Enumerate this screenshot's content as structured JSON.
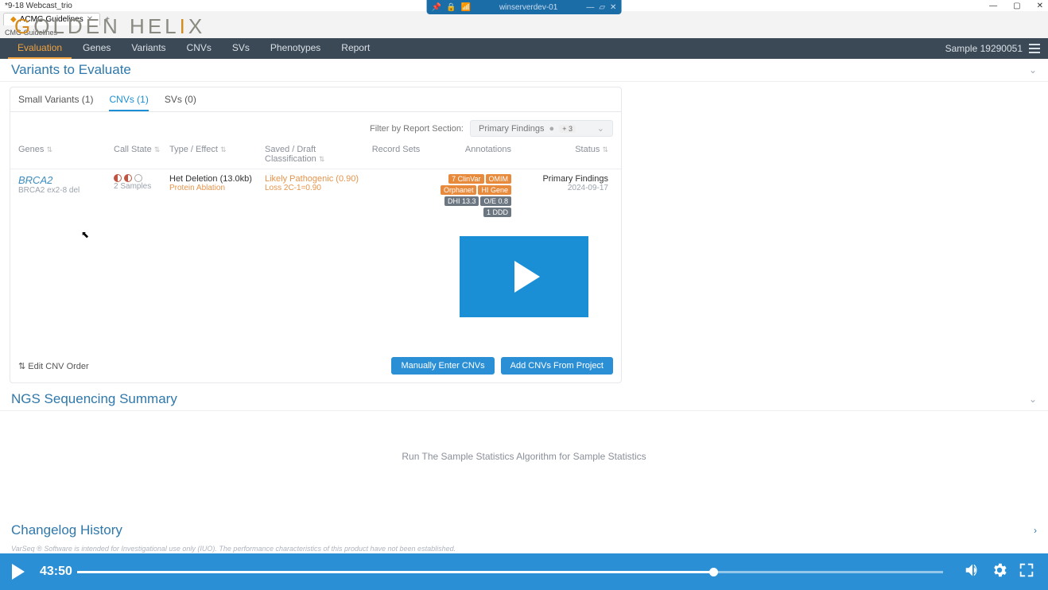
{
  "window": {
    "title": "*9-18 Webcast_trio",
    "min": "—",
    "max": "▢",
    "close": "✕"
  },
  "tab": {
    "label": "ACMG Guidelines",
    "close": "✕",
    "add": "+"
  },
  "remote": {
    "server": "winserverdev-01"
  },
  "logo": {
    "part1": "G",
    "part2": "OLDEN ",
    "part3": "H",
    "part4": "EL",
    "part5": "I",
    "part6": "X"
  },
  "app": {
    "breadcrumb": "CMG Guidelines"
  },
  "nav": {
    "tabs": [
      "Evaluation",
      "Genes",
      "Variants",
      "CNVs",
      "SVs",
      "Phenotypes",
      "Report"
    ],
    "active": 0,
    "sample": "Sample 19290051"
  },
  "section1": {
    "title": "Variants to Evaluate"
  },
  "subtabs": {
    "items": [
      "Small Variants (1)",
      "CNVs (1)",
      "SVs (0)"
    ],
    "active": 1
  },
  "filter": {
    "label": "Filter by Report Section:",
    "chip": "Primary Findings",
    "plus": "+ 3"
  },
  "columns": {
    "genes": "Genes",
    "call": "Call State",
    "type": "Type / Effect",
    "class": "Saved / Draft Classification",
    "rec": "Record Sets",
    "ann": "Annotations",
    "stat": "Status"
  },
  "row": {
    "gene": "BRCA2",
    "geneSub": "BRCA2 ex2-8 del",
    "callSub": "2 Samples",
    "type": "Het Deletion (13.0kb)",
    "typeSub": "Protein Ablation",
    "class": "Likely Pathogenic (0.90)",
    "classSub": "Loss 2C-1=0.90",
    "ann": [
      "7 ClinVar",
      "OMIM",
      "Orphanet",
      "HI Gene",
      "DHI 13.3",
      "O/E 0.8",
      "1 DDD"
    ],
    "stat": "Primary Findings",
    "statSub": "2024-09-17"
  },
  "cardfoot": {
    "edit": "Edit CNV Order",
    "b1": "Manually Enter CNVs",
    "b2": "Add CNVs From Project"
  },
  "section2": {
    "title": "NGS Sequencing Summary",
    "body": "Run The Sample Statistics Algorithm for Sample Statistics"
  },
  "section3": {
    "title": "Changelog History"
  },
  "disclaimer": "VarSeq ® Software is intended for Investigational use only (IUO). The performance characteristics of this product have not been established.",
  "video": {
    "time": "43:50"
  }
}
